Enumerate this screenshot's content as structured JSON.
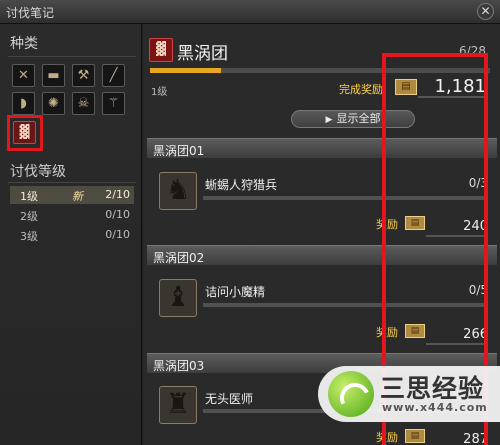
{
  "window": {
    "title": "讨伐笔记",
    "close_glyph": "✕"
  },
  "sidebar": {
    "category_header": "种类",
    "category_icons": [
      {
        "name": "sword-icon",
        "glyph": "✕"
      },
      {
        "name": "scroll-icon",
        "glyph": "▬"
      },
      {
        "name": "axe-icon",
        "glyph": "⚒"
      },
      {
        "name": "lance-icon",
        "glyph": "╱"
      },
      {
        "name": "bow-icon",
        "glyph": "◗"
      },
      {
        "name": "splash-icon",
        "glyph": "✺"
      },
      {
        "name": "skull-icon",
        "glyph": "☠"
      },
      {
        "name": "staff-icon",
        "glyph": "⚚"
      }
    ],
    "active_category_glyph": "▓",
    "levels_header": "讨伐等级",
    "levels": [
      {
        "label": "1级",
        "badge": "新",
        "count": "2/10"
      },
      {
        "label": "2级",
        "badge": "",
        "count": "0/10"
      },
      {
        "label": "3级",
        "badge": "",
        "count": "0/10"
      }
    ]
  },
  "main": {
    "set_title": "黑涡团",
    "set_count": "6/28",
    "progress_fraction": 0.21,
    "level": "1级",
    "completion_reward_label": "完成奖励",
    "completion_reward_value": "1,181",
    "show_all_label": "显示全部",
    "reward_label": "奖励",
    "groups": [
      {
        "header": "黑涡团01",
        "monster": "蜥蜴人狩猎兵",
        "count": "0/3",
        "reward": "240"
      },
      {
        "header": "黑涡团02",
        "monster": "诘问小魔精",
        "count": "0/5",
        "reward": "266"
      },
      {
        "header": "黑涡团03",
        "monster": "无头医师",
        "count": "",
        "reward": "287"
      }
    ]
  },
  "watermark": {
    "text": "三思经验",
    "url": "www.x444.com"
  }
}
